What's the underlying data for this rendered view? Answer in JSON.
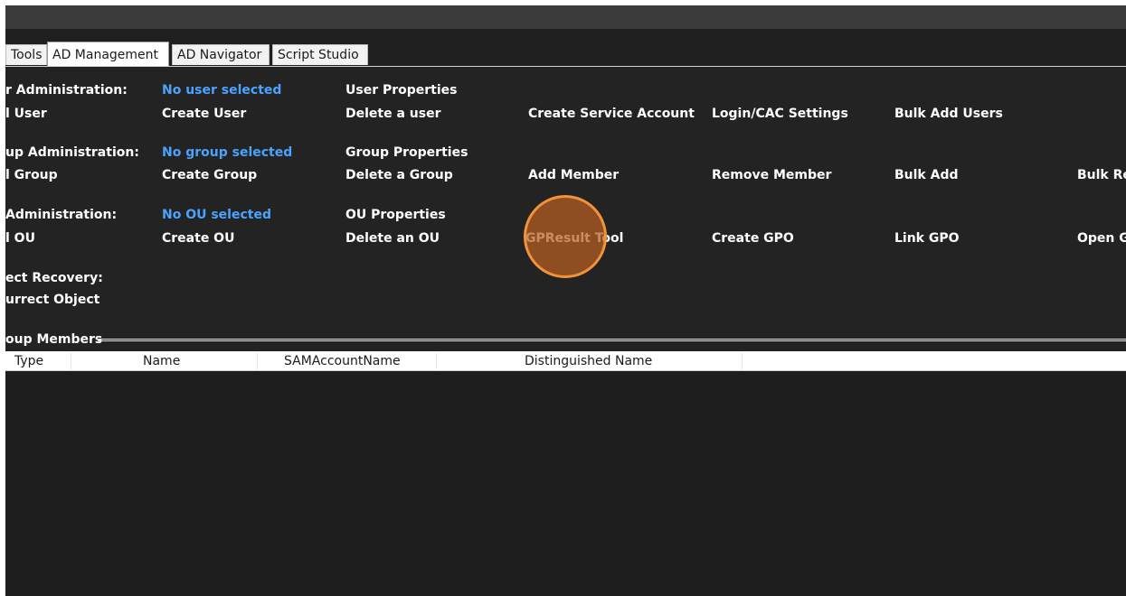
{
  "tabs": [
    "Tools",
    "AD Management",
    "AD Navigator",
    "Script Studio"
  ],
  "user_admin": {
    "label": "r Administration:",
    "selection": "No user selected",
    "properties": "User Properties",
    "actions": [
      "l User",
      "Create User",
      "Delete a user",
      "Create Service Account",
      "Login/CAC Settings",
      "Bulk Add Users"
    ]
  },
  "group_admin": {
    "label": "up Administration:",
    "selection": "No group selected",
    "properties": "Group Properties",
    "actions": [
      "l Group",
      "Create Group",
      "Delete a Group",
      "Add Member",
      "Remove Member",
      "Bulk Add",
      "Bulk Re"
    ]
  },
  "ou_admin": {
    "label": "Administration:",
    "selection": "No OU selected",
    "properties": "OU Properties",
    "actions": [
      "l OU",
      "Create OU",
      "Delete an OU",
      "GPResult Tool",
      "Create GPO",
      "Link GPO",
      "Open G"
    ]
  },
  "object_recovery": {
    "label": "ect Recovery:",
    "action": "urrect Object"
  },
  "group_members": {
    "header": "oup Members",
    "columns": [
      "Type",
      "Name",
      "SAMAccountName",
      "Distinguished Name"
    ]
  },
  "colors": {
    "background": "#232323",
    "selection_link": "#4aa3ff",
    "highlight_ring": "#f2933a"
  }
}
